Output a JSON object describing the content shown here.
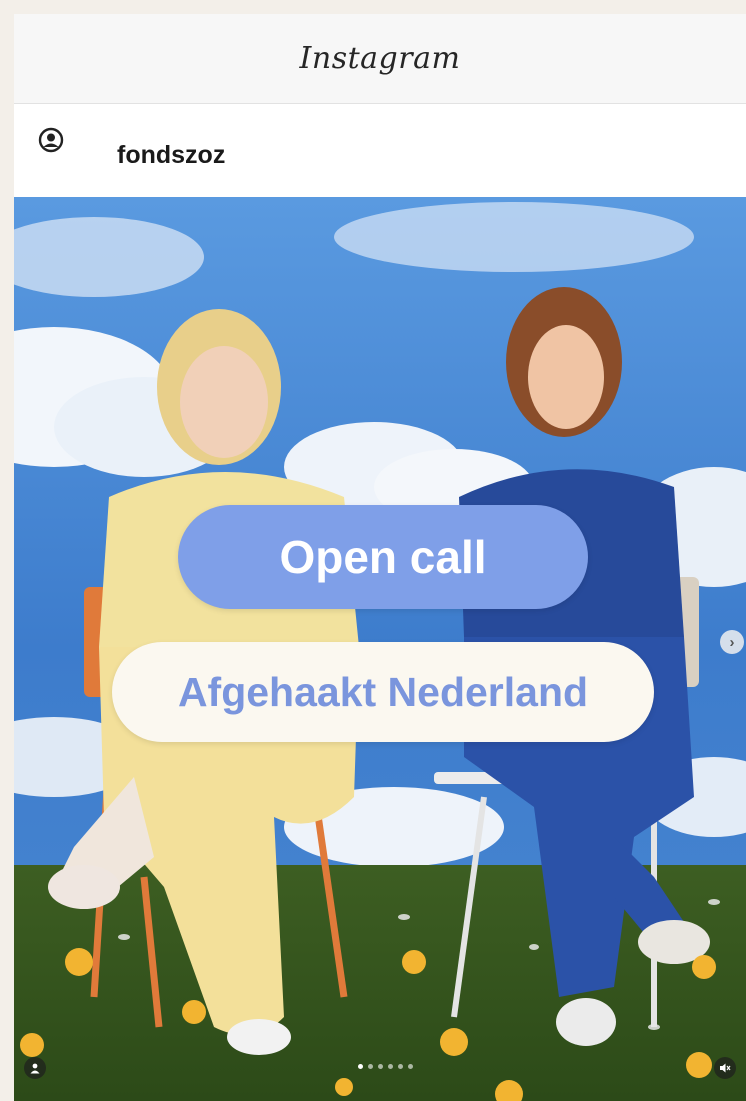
{
  "app": {
    "title": "Instagram"
  },
  "post": {
    "username": "fondszoz",
    "overlay": {
      "primary_text": "Open call",
      "secondary_text": "Afgehaakt Nederland"
    },
    "carousel": {
      "total": 6,
      "active_index": 0
    }
  },
  "icons": {
    "profile": "user-circle-icon",
    "next": "chevron-right-icon",
    "tag": "person-tag-icon",
    "sound": "muted-speaker-icon"
  },
  "colors": {
    "pill_open_bg": "#7f9fe8",
    "pill_secondary_bg": "#fbf8f0",
    "pill_secondary_text": "#7a95dd",
    "sky": "#3f7fcf"
  }
}
